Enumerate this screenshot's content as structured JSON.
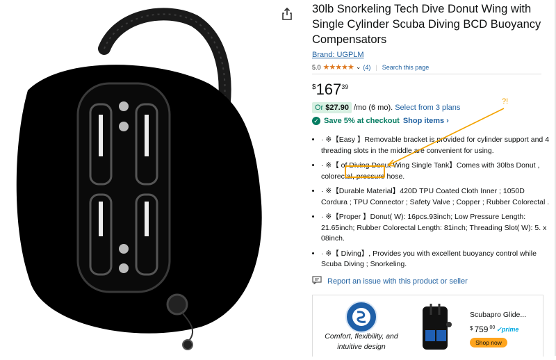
{
  "product": {
    "title": "30lb Snorkeling Tech Dive Donut Wing with Single Cylinder Scuba Diving BCD Buoyancy Compensators",
    "brand": "Brand: UGPLM",
    "rating": "5.0",
    "stars": "★★★★★",
    "review_count": "(4)",
    "search_link": "Search this page",
    "price_currency": "$",
    "price_whole": "167",
    "price_fraction": "39",
    "monthly_prefix": "Or",
    "monthly_amount": "$27.90",
    "monthly_suffix": "/mo (6 mo).",
    "monthly_plans": "Select from 3 plans",
    "save_text": "Save 5% at checkout",
    "shop_items": "Shop items ›",
    "bullets": [
      "· ※【Easy 】Removable bracket is provided for cylinder support and 4 threading slots in the middle are convenient for using.",
      "· ※【 of Diving Donut Wing Single Tank】Comes with 30lbs Donut , colorectal, pressure hose.",
      "· ※【Durable Material】420D TPU Coated Cloth Inner ; 1050D Cordura ; TPU Connector ; Safety Valve ; Copper ; Rubber Colorectal .",
      "· ※【Proper 】Donut( W): 16pcs.93inch; Low Pressure Length: 21.65inch; Rubber Colorectal Length: 81inch; Threading Slot( W): 5. x 08inch.",
      "· ※【 Diving】, Provides you with excellent buoyancy control while Scuba Diving ; Snorkeling."
    ],
    "report_link": "Report an issue with this product or seller"
  },
  "annotation": {
    "label": "?!",
    "color": "#f4a300"
  },
  "ad": {
    "tagline": "Comfort, flexibility, and intuitive design",
    "product_name": "Scubapro Glide...",
    "price_currency": "$",
    "price_whole": "759",
    "price_fraction": "00",
    "prime_label": "✓prime",
    "shop_button": "Shop now"
  },
  "colors": {
    "link": "#2162a1",
    "star": "#de7921",
    "deal_green": "#067d62",
    "button": "#ffa41c"
  }
}
